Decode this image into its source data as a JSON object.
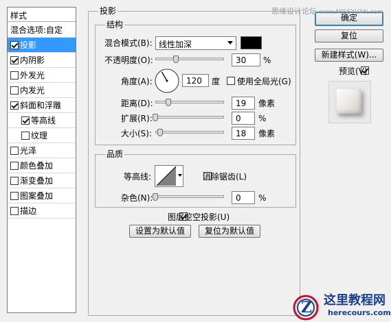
{
  "style_list": {
    "header": "样式",
    "blending_options": "混合选项:自定",
    "items": [
      {
        "label": "投影",
        "checked": true,
        "selected": true
      },
      {
        "label": "内阴影",
        "checked": true
      },
      {
        "label": "外发光",
        "checked": false
      },
      {
        "label": "内发光",
        "checked": false
      },
      {
        "label": "斜面和浮雕",
        "checked": true
      },
      {
        "label": "等高线",
        "checked": true,
        "sub": true
      },
      {
        "label": "纹理",
        "checked": false,
        "sub": true
      },
      {
        "label": "光泽",
        "checked": false
      },
      {
        "label": "颜色叠加",
        "checked": false
      },
      {
        "label": "渐变叠加",
        "checked": false
      },
      {
        "label": "图案叠加",
        "checked": false
      },
      {
        "label": "描边",
        "checked": false
      }
    ]
  },
  "drop_shadow": {
    "title": "投影",
    "structure": {
      "title": "结构",
      "blend_mode_label": "混合模式(B):",
      "blend_mode_value": "线性加深",
      "blend_color": "#000000",
      "opacity_label": "不透明度(O):",
      "opacity_value": "30",
      "opacity_unit": "%",
      "opacity_level": 0.3,
      "angle_label": "角度(A):",
      "angle_value": "120",
      "angle_unit": "度",
      "use_global_light_label": "使用全局光(G)",
      "use_global_light_checked": false,
      "distance_label": "距离(D):",
      "distance_value": "19",
      "distance_unit": "像素",
      "distance_level": 0.19,
      "spread_label": "扩展(R):",
      "spread_value": "0",
      "spread_unit": "%",
      "spread_level": 0,
      "size_label": "大小(S):",
      "size_value": "18",
      "size_unit": "像素",
      "size_level": 0.07
    },
    "quality": {
      "title": "品质",
      "contour_label": "等高线:",
      "anti_alias_label": "消除锯齿(L)",
      "anti_alias_checked": false,
      "noise_label": "杂色(N):",
      "noise_value": "0",
      "noise_unit": "%",
      "noise_level": 0
    },
    "knockout_label": "图层挖空投影(U)",
    "knockout_checked": true,
    "make_default_label": "设置为默认值",
    "reset_default_label": "复位为默认值"
  },
  "right_panel": {
    "ok_label": "确定",
    "reset_label": "复位",
    "new_style_label": "新建样式(W)...",
    "preview_label": "预览(V)",
    "preview_checked": true
  },
  "watermark": {
    "text": "思缘设计论坛",
    "url": "www.MISSYUAN.com"
  },
  "logo": {
    "title": "这里教程网",
    "url": "herecours.com",
    "letter": "Z",
    "brand_color": "#1a3f8c",
    "accent_color": "#c8102e"
  }
}
